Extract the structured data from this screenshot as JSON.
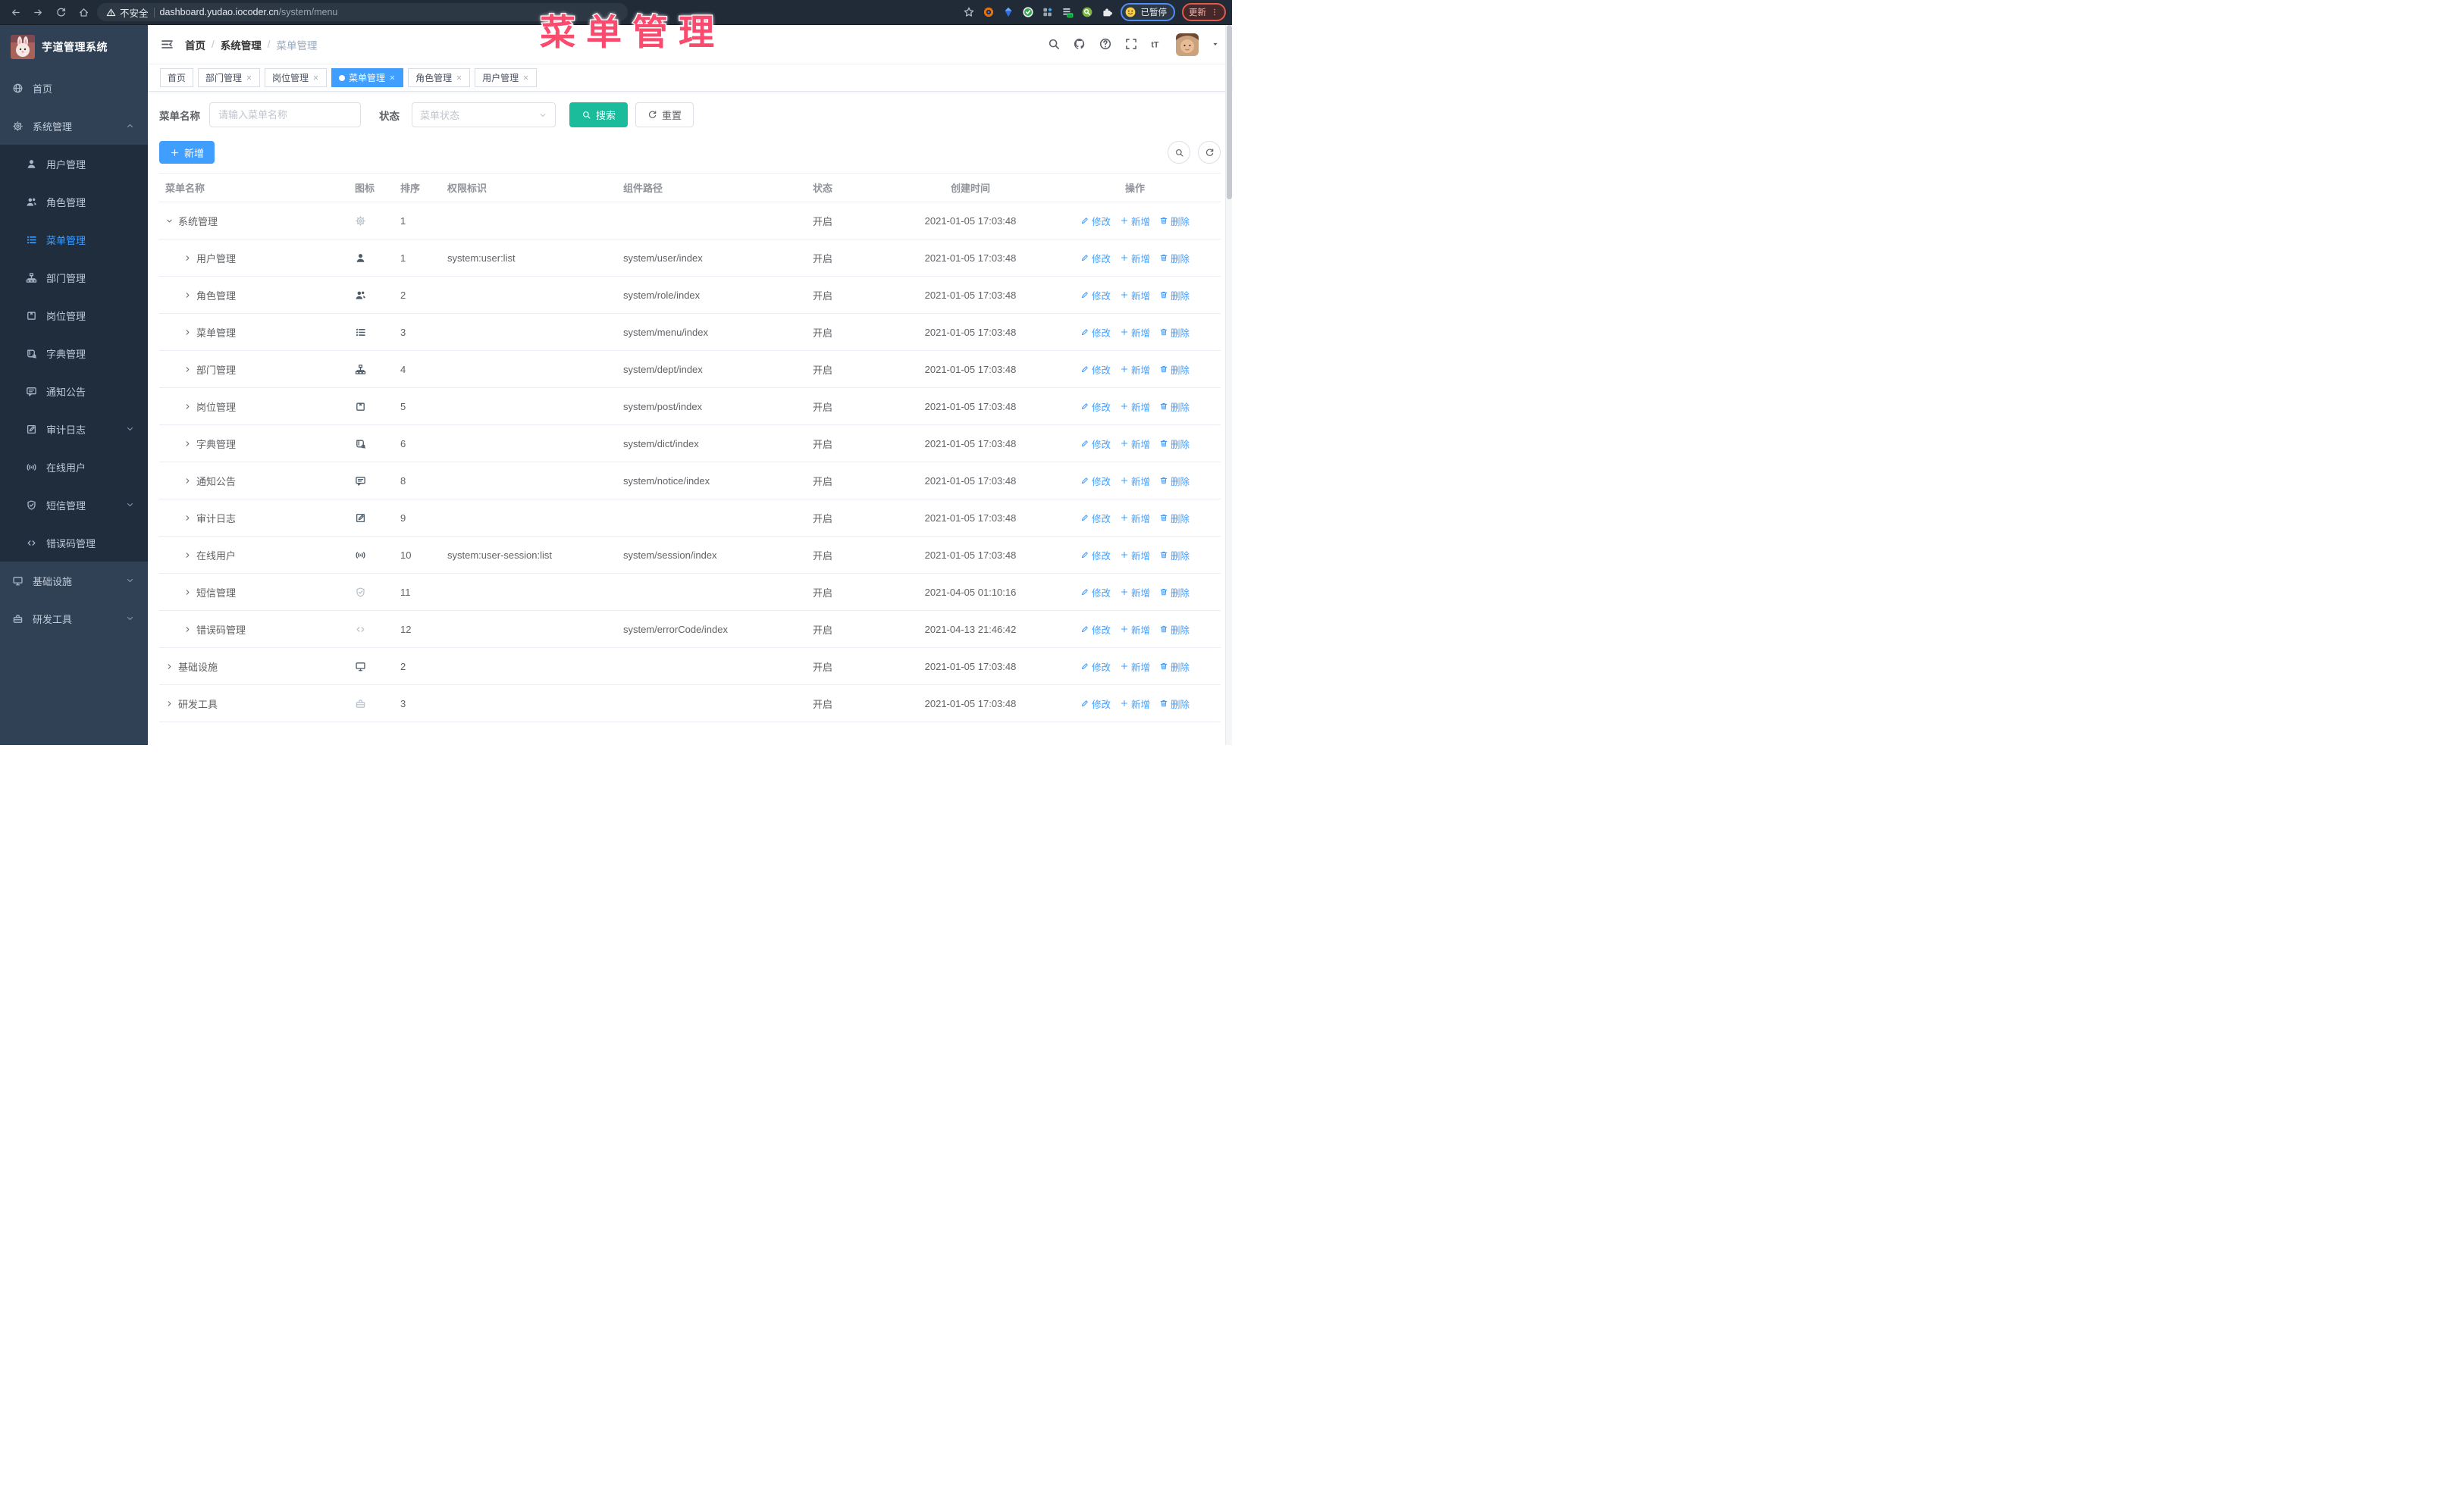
{
  "colors": {
    "accent": "#409eff",
    "search_teal": "#1abc9c",
    "overlay_pink": "#fa4b6f",
    "sidebar_bg": "#304156",
    "submenu_bg": "#1f2d3d"
  },
  "overlay_title": "菜单管理",
  "browser": {
    "security_label": "不安全",
    "url_host": "dashboard.yudao.iocoder.cn",
    "url_path": "/system/menu",
    "paused_badge": "已暂停",
    "update_button": "更新",
    "extensions": [
      "bookmark-star-icon",
      "orange-ring-icon",
      "blue-gem-icon",
      "green-check-icon",
      "grid-gem-icon",
      "bars-on-icon",
      "green-search-icon",
      "puzzle-icon"
    ],
    "on_badge": "on"
  },
  "sidebar": {
    "app_title": "芋道管理系统",
    "items": [
      {
        "icon": "globe-icon",
        "label": "首页"
      },
      {
        "icon": "gear-icon",
        "label": "系统管理",
        "chevron": "up",
        "open": true,
        "children": [
          {
            "icon": "user-icon",
            "label": "用户管理"
          },
          {
            "icon": "users-icon",
            "label": "角色管理"
          },
          {
            "icon": "menulist-icon",
            "label": "菜单管理",
            "active": true
          },
          {
            "icon": "tree-icon",
            "label": "部门管理"
          },
          {
            "icon": "badge-icon",
            "label": "岗位管理"
          },
          {
            "icon": "book-icon",
            "label": "字典管理"
          },
          {
            "icon": "message-icon",
            "label": "通知公告"
          },
          {
            "icon": "log-icon",
            "label": "审计日志",
            "chevron": "down"
          },
          {
            "icon": "online-icon",
            "label": "在线用户"
          },
          {
            "icon": "shield-icon",
            "label": "短信管理",
            "chevron": "down"
          },
          {
            "icon": "code-icon",
            "label": "错误码管理"
          }
        ]
      },
      {
        "icon": "monitor-icon",
        "label": "基础设施",
        "chevron": "down"
      },
      {
        "icon": "toolbox-icon",
        "label": "研发工具",
        "chevron": "down"
      }
    ]
  },
  "topbar": {
    "breadcrumb": [
      "首页",
      "系统管理",
      "菜单管理"
    ],
    "right_icons": [
      "search-icon",
      "github-icon",
      "question-icon",
      "fullscreen-icon",
      "fontsize-icon"
    ]
  },
  "tabs": [
    {
      "label": "首页",
      "closable": false,
      "active": false
    },
    {
      "label": "部门管理",
      "closable": true,
      "active": false
    },
    {
      "label": "岗位管理",
      "closable": true,
      "active": false
    },
    {
      "label": "菜单管理",
      "closable": true,
      "active": true
    },
    {
      "label": "角色管理",
      "closable": true,
      "active": false
    },
    {
      "label": "用户管理",
      "closable": true,
      "active": false
    }
  ],
  "filters": {
    "name_label": "菜单名称",
    "name_placeholder": "请输入菜单名称",
    "status_label": "状态",
    "status_placeholder": "菜单状态",
    "search_button": "搜索",
    "reset_button": "重置"
  },
  "toolbar": {
    "add_button": "新增"
  },
  "table": {
    "columns": [
      "菜单名称",
      "图标",
      "排序",
      "权限标识",
      "组件路径",
      "状态",
      "创建时间",
      "操作"
    ],
    "op_labels": [
      {
        "icon": "edit-icon",
        "label": "修改"
      },
      {
        "icon": "plus-icon",
        "label": "新增"
      },
      {
        "icon": "trash-icon",
        "label": "删除"
      }
    ],
    "rows": [
      {
        "level": 0,
        "expanded": true,
        "name": "系统管理",
        "icon": "gear-icon",
        "icon_muted": true,
        "sort": "1",
        "perm": "",
        "path": "",
        "status": "开启",
        "time": "2021-01-05 17:03:48"
      },
      {
        "level": 1,
        "expanded": false,
        "name": "用户管理",
        "icon": "user-icon",
        "icon_muted": false,
        "sort": "1",
        "perm": "system:user:list",
        "path": "system/user/index",
        "status": "开启",
        "time": "2021-01-05 17:03:48"
      },
      {
        "level": 1,
        "expanded": false,
        "name": "角色管理",
        "icon": "users-icon",
        "icon_muted": false,
        "sort": "2",
        "perm": "",
        "path": "system/role/index",
        "status": "开启",
        "time": "2021-01-05 17:03:48"
      },
      {
        "level": 1,
        "expanded": false,
        "name": "菜单管理",
        "icon": "menulist-icon",
        "icon_muted": false,
        "sort": "3",
        "perm": "",
        "path": "system/menu/index",
        "status": "开启",
        "time": "2021-01-05 17:03:48"
      },
      {
        "level": 1,
        "expanded": false,
        "name": "部门管理",
        "icon": "tree-icon",
        "icon_muted": false,
        "sort": "4",
        "perm": "",
        "path": "system/dept/index",
        "status": "开启",
        "time": "2021-01-05 17:03:48"
      },
      {
        "level": 1,
        "expanded": false,
        "name": "岗位管理",
        "icon": "badge-icon",
        "icon_muted": false,
        "sort": "5",
        "perm": "",
        "path": "system/post/index",
        "status": "开启",
        "time": "2021-01-05 17:03:48"
      },
      {
        "level": 1,
        "expanded": false,
        "name": "字典管理",
        "icon": "book-icon",
        "icon_muted": false,
        "sort": "6",
        "perm": "",
        "path": "system/dict/index",
        "status": "开启",
        "time": "2021-01-05 17:03:48"
      },
      {
        "level": 1,
        "expanded": false,
        "name": "通知公告",
        "icon": "message-icon",
        "icon_muted": false,
        "sort": "8",
        "perm": "",
        "path": "system/notice/index",
        "status": "开启",
        "time": "2021-01-05 17:03:48"
      },
      {
        "level": 1,
        "expanded": false,
        "name": "审计日志",
        "icon": "log-icon",
        "icon_muted": false,
        "sort": "9",
        "perm": "",
        "path": "",
        "status": "开启",
        "time": "2021-01-05 17:03:48"
      },
      {
        "level": 1,
        "expanded": false,
        "name": "在线用户",
        "icon": "online-icon",
        "icon_muted": false,
        "sort": "10",
        "perm": "system:user-session:list",
        "path": "system/session/index",
        "status": "开启",
        "time": "2021-01-05 17:03:48"
      },
      {
        "level": 1,
        "expanded": false,
        "name": "短信管理",
        "icon": "shield-icon",
        "icon_muted": true,
        "sort": "11",
        "perm": "",
        "path": "",
        "status": "开启",
        "time": "2021-04-05 01:10:16"
      },
      {
        "level": 1,
        "expanded": false,
        "name": "错误码管理",
        "icon": "code-icon",
        "icon_muted": true,
        "sort": "12",
        "perm": "",
        "path": "system/errorCode/index",
        "status": "开启",
        "time": "2021-04-13 21:46:42"
      },
      {
        "level": 0,
        "expanded": false,
        "name": "基础设施",
        "icon": "monitor-icon",
        "icon_muted": false,
        "sort": "2",
        "perm": "",
        "path": "",
        "status": "开启",
        "time": "2021-01-05 17:03:48"
      },
      {
        "level": 0,
        "expanded": false,
        "name": "研发工具",
        "icon": "toolbox-icon",
        "icon_muted": true,
        "sort": "3",
        "perm": "",
        "path": "",
        "status": "开启",
        "time": "2021-01-05 17:03:48"
      }
    ]
  }
}
